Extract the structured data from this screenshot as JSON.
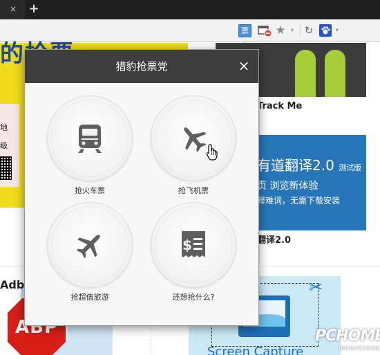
{
  "browser": {
    "tab_close": "×",
    "new_tab": "+",
    "toolbar": {
      "ticket_ext": "票",
      "star": "★",
      "caret": "▾",
      "refresh": "↻"
    }
  },
  "page": {
    "yellow_banner_text": "的抢票",
    "qr_card_lines": [
      "地",
      "级"
    ],
    "trackme_label": "Track Me",
    "youdao": {
      "title": "有道翻译2.0",
      "badge": "测试版",
      "line1": "页 浏览新体验",
      "line2": "释难词，无需下载安装",
      "label": "翻译2.0"
    },
    "adb_label": "Adb",
    "abp_text": "ABP",
    "screen_capture_label": "Screen Capture",
    "watermark": "PCHOME",
    "watermark_sub": "WWW.PCHOME.NET"
  },
  "popup": {
    "title": "猎豹抢票党",
    "close": "×",
    "options": [
      {
        "label": "抢火车票",
        "icon": "train-icon"
      },
      {
        "label": "抢飞机票",
        "icon": "airplane-icon"
      },
      {
        "label": "抢超值旅游",
        "icon": "airplane-icon"
      },
      {
        "label": "还想抢什么?",
        "icon": "receipt-dollar-icon"
      }
    ]
  },
  "colors": {
    "popup_header": "#3d3d3d",
    "icon_gray": "#5f5f5f",
    "yellow_banner": "#f0dc1a",
    "youdao_blue": "#2776b8",
    "abp_red": "#d91e18"
  }
}
